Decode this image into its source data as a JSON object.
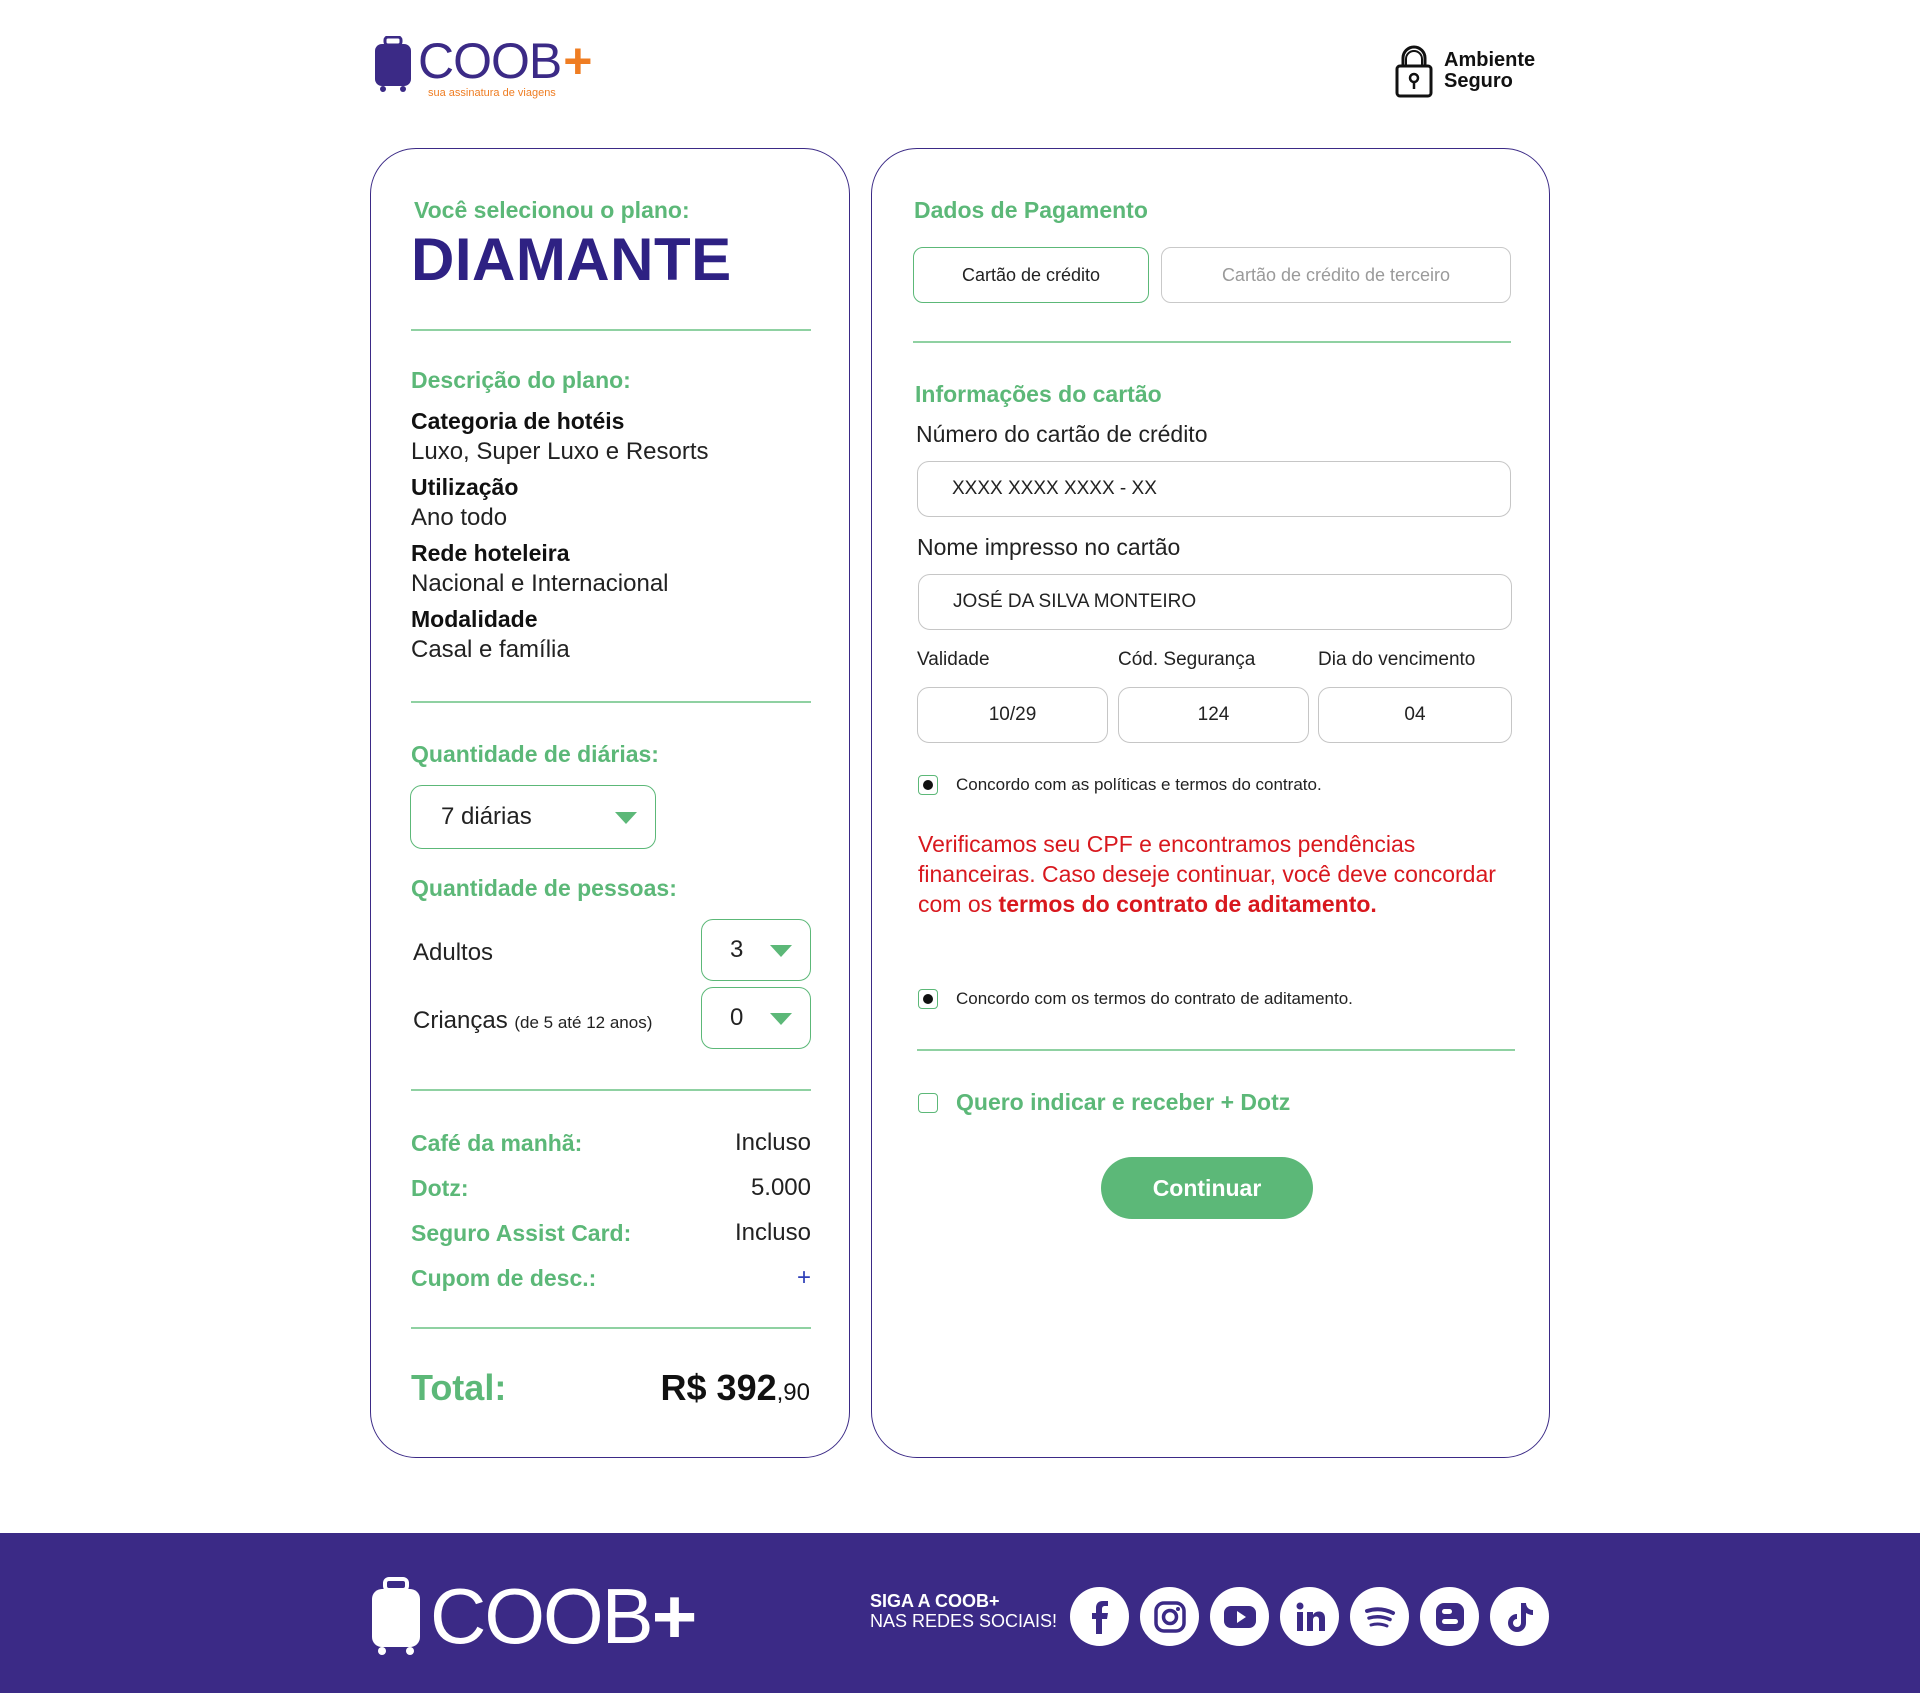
{
  "header": {
    "brand": "COOB",
    "brand_plus": "+",
    "tagline": "sua assinatura de viagens",
    "secure_line1": "Ambiente",
    "secure_line2": "Seguro"
  },
  "plan": {
    "selected_label": "Você selecionou o plano:",
    "name": "DIAMANTE",
    "description_label": "Descrição do plano:",
    "details": [
      {
        "key": "Categoria de hotéis",
        "value": "Luxo, Super Luxo e Resorts"
      },
      {
        "key": "Utilização",
        "value": "Ano todo"
      },
      {
        "key": "Rede hoteleira",
        "value": "Nacional e Internacional"
      },
      {
        "key": "Modalidade",
        "value": "Casal e família"
      }
    ],
    "diarias_label": "Quantidade de diárias:",
    "diarias_value": "7 diárias",
    "pessoas_label": "Quantidade de pessoas:",
    "adultos_label": "Adultos",
    "adultos_value": "3",
    "criancas_label": "Crianças",
    "criancas_note": "(de 5 até 12 anos)",
    "criancas_value": "0",
    "extras": [
      {
        "key": "Café da manhã:",
        "value": "Incluso"
      },
      {
        "key": "Dotz:",
        "value": "5.000"
      },
      {
        "key": "Seguro Assist Card:",
        "value": "Incluso"
      },
      {
        "key": "Cupom de desc.:",
        "value": "+"
      }
    ],
    "total_label": "Total:",
    "total_value": "R$ 392",
    "total_cents": ",90"
  },
  "payment": {
    "title": "Dados de Pagamento",
    "tab_own": "Cartão de crédito",
    "tab_third": "Cartão de crédito de terceiro",
    "card_info_label": "Informações do cartão",
    "number_label": "Número do cartão de crédito",
    "number_value": "XXXX XXXX XXXX - XX",
    "name_label": "Nome impresso no cartão",
    "name_value": "JOSÉ DA SILVA MONTEIRO",
    "validity_label": "Validade",
    "validity_value": "10/29",
    "cvv_label": "Cód. Segurança",
    "cvv_value": "124",
    "due_label": "Dia do vencimento",
    "due_value": "04",
    "agree_terms": "Concordo com as políticas e termos do contrato.",
    "warning_text": "Verificamos seu CPF e encontramos pendências financeiras. Caso deseje continuar, você deve concordar com os ",
    "warning_bold": "termos do contrato de aditamento.",
    "agree_addendum": "Concordo com os termos do contrato de aditamento.",
    "refer_label": "Quero indicar e receber + Dotz",
    "continue_label": "Continuar"
  },
  "footer": {
    "brand": "COOB",
    "brand_plus": "+",
    "follow_line1": "SIGA A COOB+",
    "follow_line2": "NAS REDES SOCIAIS!",
    "socials": [
      "facebook-icon",
      "instagram-icon",
      "youtube-icon",
      "linkedin-icon",
      "spotify-icon",
      "blogger-icon",
      "tiktok-icon"
    ]
  },
  "colors": {
    "brand_purple": "#3b2a86",
    "brand_orange": "#ef7d22",
    "accent_green": "#5cb878",
    "warning_red": "#d8181e"
  }
}
